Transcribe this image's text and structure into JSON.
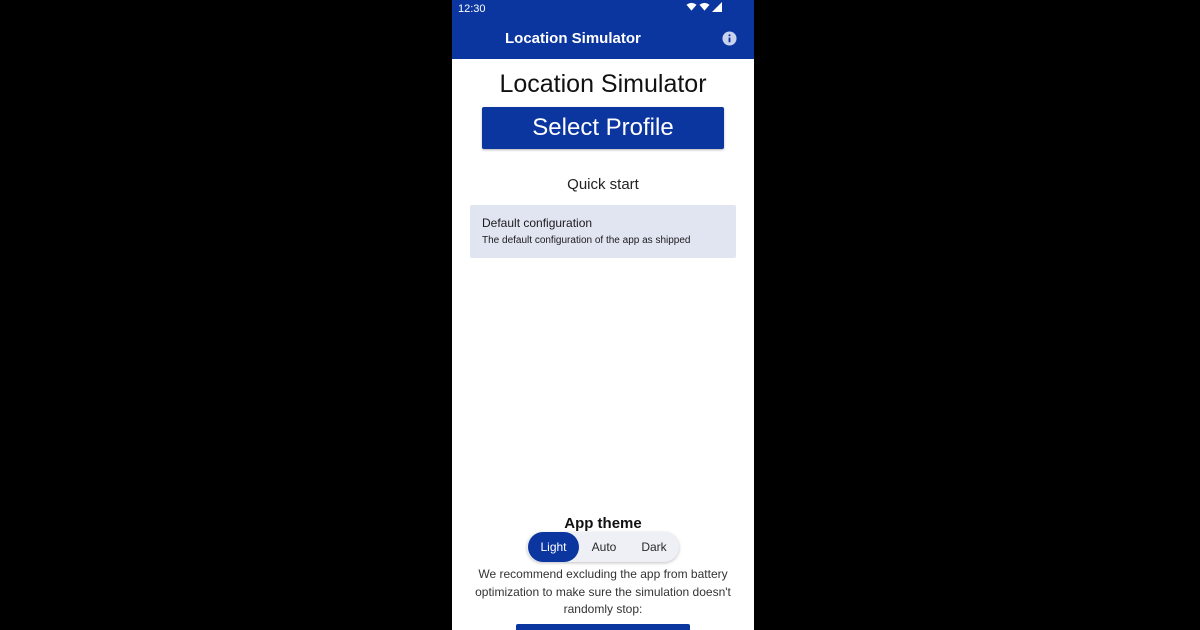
{
  "status_bar": {
    "time": "12:30",
    "icons": [
      "wifi-icon",
      "wifi-icon",
      "signal-icon"
    ]
  },
  "app_bar": {
    "title": "Location Simulator",
    "info_icon": "info-icon"
  },
  "main": {
    "heading": "Location Simulator",
    "select_profile_label": "Select Profile",
    "quick_start_label": "Quick start",
    "quick_start_items": [
      {
        "title": "Default configuration",
        "description": "The default configuration of the app as shipped"
      }
    ]
  },
  "theme": {
    "heading": "App theme",
    "options": [
      "Light",
      "Auto",
      "Dark"
    ],
    "selected": "Light"
  },
  "battery_note": "We recommend excluding the app from battery optimization to make sure the simulation doesn't randomly stop:",
  "colors": {
    "primary": "#0b36a0",
    "card_background": "#e1e5f2",
    "background": "#ffffff"
  }
}
